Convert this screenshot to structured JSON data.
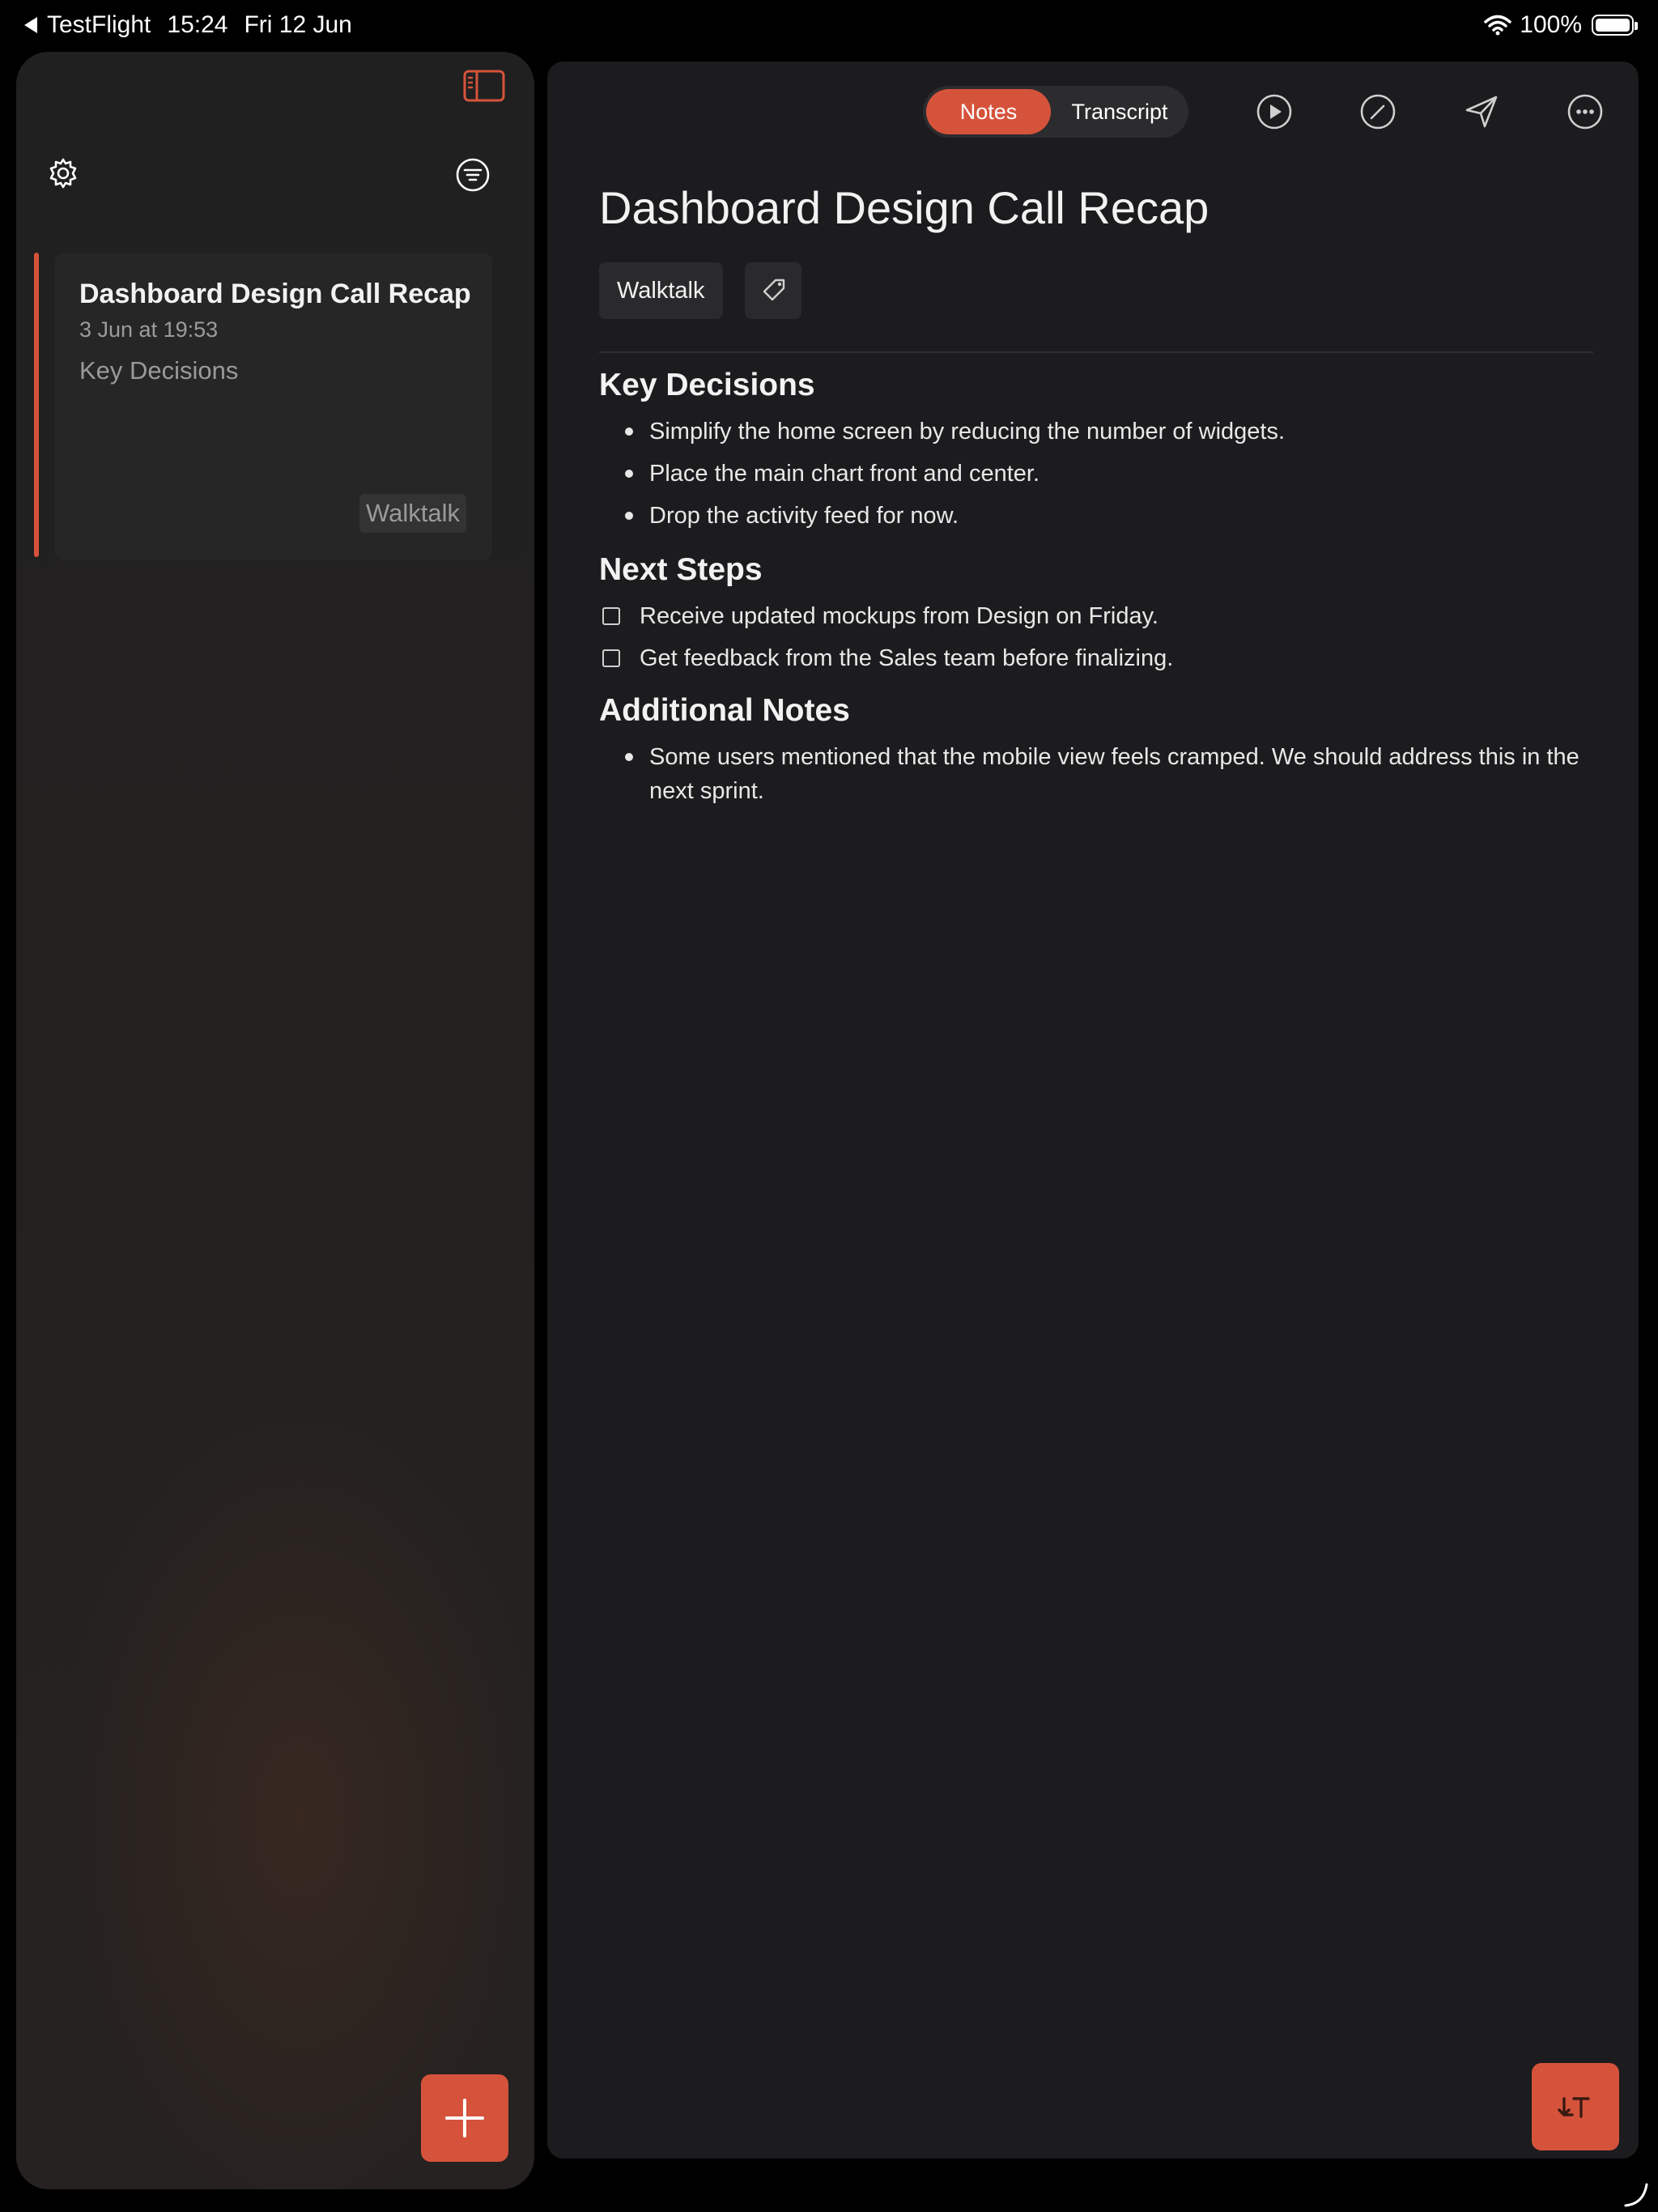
{
  "status_bar": {
    "back_app": "TestFlight",
    "time": "15:24",
    "date": "Fri 12 Jun",
    "battery": "100%"
  },
  "sidebar": {
    "notes": [
      {
        "title": "Dashboard Design Call Recap",
        "date": "3 Jun at 19:53",
        "preview": "Key Decisions",
        "tag": "Walktalk"
      }
    ]
  },
  "toolbar": {
    "segments": {
      "notes": "Notes",
      "transcript": "Transcript"
    },
    "selected": "Notes"
  },
  "document": {
    "title": "Dashboard Design Call Recap",
    "tag": "Walktalk",
    "sections": [
      {
        "heading": "Key Decisions",
        "items": [
          "Simplify the home screen by reducing the number of widgets.",
          "Place the main chart front and center.",
          "Drop the activity feed for now."
        ]
      },
      {
        "heading": "Next Steps",
        "items": [
          "Receive updated mockups from Design on Friday.",
          "Get feedback from the Sales team before finalizing."
        ]
      },
      {
        "heading": "Additional Notes",
        "items": [
          "Some users mentioned that the mobile view feels cramped. We should address this in the next sprint."
        ]
      }
    ]
  },
  "colors": {
    "accent": "#d6533b",
    "panel": "#1c1c1e",
    "sidebar": "#232323"
  },
  "icons": {
    "sidebar_toggle": "sidebar-toggle-icon",
    "settings": "gear-icon",
    "filter": "filter-icon",
    "play": "play-icon",
    "edit": "edit-icon",
    "share": "send-icon",
    "more": "more-icon",
    "tag": "tag-icon",
    "add": "plus-icon",
    "transcribe": "transcribe-icon"
  }
}
